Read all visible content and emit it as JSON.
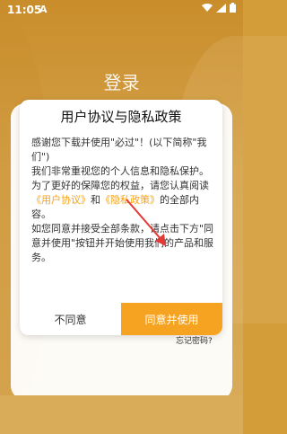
{
  "status_bar": {
    "time": "11:05",
    "notification_icon": "A"
  },
  "login": {
    "title": "登录",
    "forgot_password": "忘记密码?"
  },
  "dialog": {
    "title": "用户协议与隐私政策",
    "body": {
      "line1_pre": "感谢您下载并使用\"必过\"！(以下简称\"我们\")",
      "line2": "我们非常重视您的个人信息和隐私保护。为了更好的保障您的权益，请您认真阅读",
      "link_user_agreement": "《用户协议》",
      "and": "和",
      "link_privacy": "《隐私政策》",
      "line3": "的全部内容。",
      "line4": "如您同意并接受全部条款，请点击下方\"同意并使用\"按钮并开始使用我们的产品和服务。"
    },
    "buttons": {
      "disagree": "不同意",
      "agree": "同意并使用"
    }
  },
  "colors": {
    "accent": "#f7a322",
    "background": "#d39d3a",
    "annotation_arrow": "#e53935"
  }
}
